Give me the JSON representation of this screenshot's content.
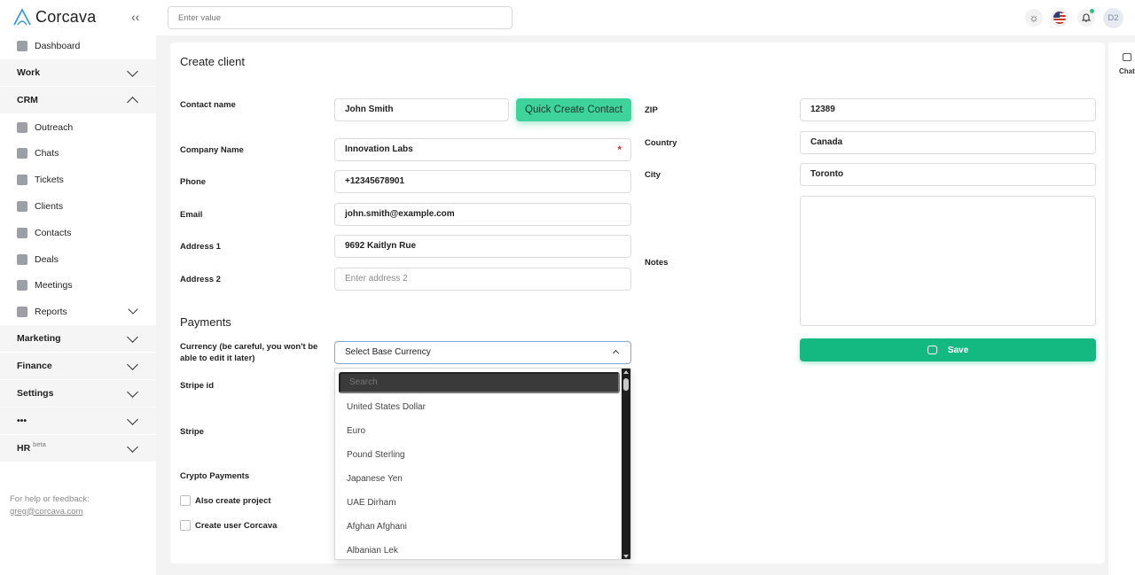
{
  "brand": {
    "name": "Corcava"
  },
  "topbar": {
    "search_placeholder": "Enter value",
    "avatar_initials": "D2"
  },
  "sidebar": {
    "items": [
      {
        "label": "Dashboard",
        "kind": "item",
        "icon": "dashboard-icon"
      },
      {
        "label": "Work",
        "kind": "group",
        "expanded": false
      },
      {
        "label": "CRM",
        "kind": "group",
        "expanded": true
      },
      {
        "label": "Outreach",
        "kind": "item",
        "icon": "outreach-icon"
      },
      {
        "label": "Chats",
        "kind": "item",
        "icon": "chats-icon"
      },
      {
        "label": "Tickets",
        "kind": "item",
        "icon": "tickets-icon"
      },
      {
        "label": "Clients",
        "kind": "item",
        "icon": "clients-icon"
      },
      {
        "label": "Contacts",
        "kind": "item",
        "icon": "contacts-icon"
      },
      {
        "label": "Deals",
        "kind": "item",
        "icon": "deals-icon"
      },
      {
        "label": "Meetings",
        "kind": "item",
        "icon": "meetings-icon"
      },
      {
        "label": "Reports",
        "kind": "item",
        "icon": "reports-icon"
      },
      {
        "label": "Marketing",
        "kind": "group",
        "expanded": false
      },
      {
        "label": "Finance",
        "kind": "group",
        "expanded": false
      },
      {
        "label": "Settings",
        "kind": "group",
        "expanded": false
      },
      {
        "label": "•••",
        "kind": "group",
        "expanded": false
      },
      {
        "label": "HR",
        "kind": "group",
        "expanded": false,
        "badge": "beta"
      }
    ],
    "help_text": "For help or feedback:",
    "help_email": "greg@corcava.com"
  },
  "chat_rail": {
    "label": "Chat"
  },
  "form": {
    "title": "Create client",
    "labels": {
      "contact_name": "Contact name",
      "company_name": "Company Name",
      "phone": "Phone",
      "email": "Email",
      "address1": "Address 1",
      "address2": "Address 2",
      "zip": "ZIP",
      "country": "Country",
      "city": "City",
      "notes": "Notes"
    },
    "values": {
      "contact_name": "John Smith",
      "company_name": "Innovation Labs",
      "phone": "+12345678901",
      "email": "john.smith@example.com",
      "address1": "9692 Kaitlyn Rue",
      "address2": "",
      "zip": "12389",
      "country": "Canada",
      "city": "Toronto",
      "notes": ""
    },
    "placeholders": {
      "address2": "Enter address 2"
    },
    "required_mark": "*",
    "quick_create_label": "Quick Create Contact",
    "save_label": "Save"
  },
  "payments": {
    "title": "Payments",
    "currency_label": "Currency (be careful, you won't be able to edit it later)",
    "currency_selected": "Select Base Currency",
    "stripe_id_label": "Stripe id",
    "stripe_label": "Stripe",
    "crypto_label": "Crypto Payments",
    "also_create_project_label": "Also create project",
    "create_user_label": "Create user Corcava"
  },
  "currency_dropdown": {
    "search_placeholder": "Search",
    "options": [
      "United States Dollar",
      "Euro",
      "Pound Sterling",
      "Japanese Yen",
      "UAE Dirham",
      "Afghan Afghani",
      "Albanian Lek"
    ]
  },
  "colors": {
    "accent": "#14b981",
    "quick_create": "#3fd39c",
    "required": "#e03131",
    "select_focus_border": "#7da8d8"
  }
}
